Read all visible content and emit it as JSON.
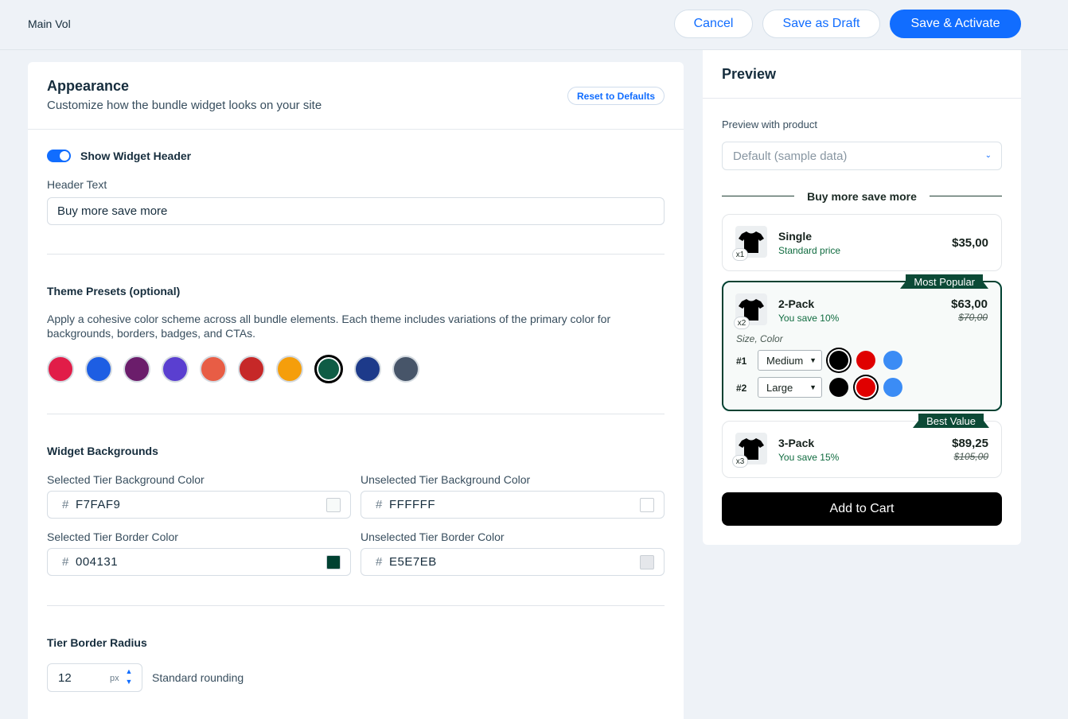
{
  "topbar": {
    "title": "Main Vol",
    "cancel_label": "Cancel",
    "draft_label": "Save as Draft",
    "activate_label": "Save & Activate"
  },
  "appearance": {
    "title": "Appearance",
    "subtitle": "Customize how the bundle widget looks on your site",
    "reset_label": "Reset to Defaults",
    "show_header_label": "Show Widget Header",
    "show_header_on": true,
    "header_text_label": "Header Text",
    "header_text_value": "Buy more save more"
  },
  "themes": {
    "title": "Theme Presets (optional)",
    "description": "Apply a cohesive color scheme across all bundle elements. Each theme includes variations of the primary color for backgrounds, borders, badges, and CTAs.",
    "swatches": [
      "#e11d48",
      "#1d5ee3",
      "#6b1d6b",
      "#5a3fd0",
      "#e85d45",
      "#c62828",
      "#f59e0b",
      "#0f5c45",
      "#1d3a8a",
      "#475569"
    ],
    "selected_index": 7
  },
  "backgrounds": {
    "title": "Widget Backgrounds",
    "selected_bg_label": "Selected Tier Background Color",
    "selected_bg_value": "F7FAF9",
    "selected_bg_color": "#F7FAF9",
    "unselected_bg_label": "Unselected Tier Background Color",
    "unselected_bg_value": "FFFFFF",
    "unselected_bg_color": "#FFFFFF",
    "selected_border_label": "Selected Tier Border Color",
    "selected_border_value": "004131",
    "selected_border_color": "#004131",
    "unselected_border_label": "Unselected Tier Border Color",
    "unselected_border_value": "E5E7EB",
    "unselected_border_color": "#E5E7EB",
    "hash": "#"
  },
  "radius": {
    "title": "Tier Border Radius",
    "value": "12",
    "unit": "px",
    "hint": "Standard rounding"
  },
  "preview": {
    "title": "Preview",
    "product_label": "Preview with product",
    "product_value": "Default (sample data)",
    "header_text": "Buy more save more",
    "tiers": [
      {
        "qty": "x1",
        "name": "Single",
        "sub": "Standard price",
        "price": "$35,00",
        "old_price": "",
        "badge": ""
      },
      {
        "qty": "x2",
        "name": "2-Pack",
        "sub": "You save 10%",
        "price": "$63,00",
        "old_price": "$70,00",
        "badge": "Most Popular"
      },
      {
        "qty": "x3",
        "name": "3-Pack",
        "sub": "You save 15%",
        "price": "$89,25",
        "old_price": "$105,00",
        "badge": "Best Value"
      }
    ],
    "options_label": "Size, Color",
    "options": [
      {
        "num": "#1",
        "size": "Medium",
        "colors": [
          "#000000",
          "#e00000",
          "#3b8cf5"
        ],
        "selected_color": 0
      },
      {
        "num": "#2",
        "size": "Large",
        "colors": [
          "#000000",
          "#e00000",
          "#3b8cf5"
        ],
        "selected_color": 1
      }
    ],
    "cart_label": "Add to Cart"
  }
}
